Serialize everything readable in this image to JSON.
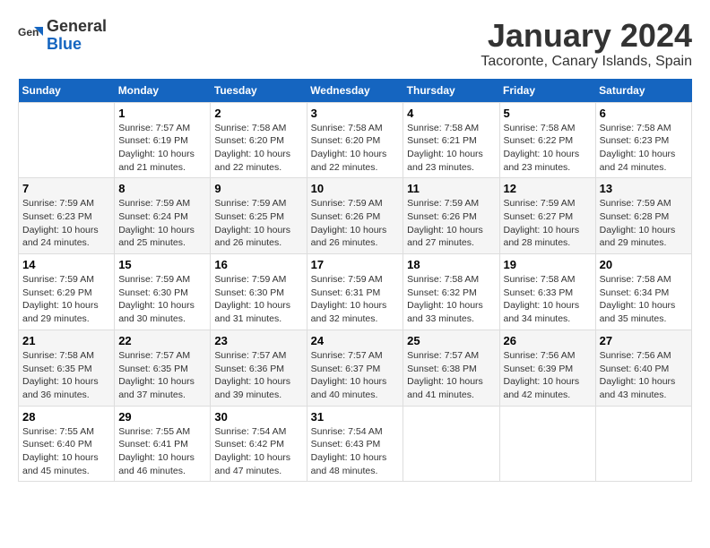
{
  "logo": {
    "general": "General",
    "blue": "Blue"
  },
  "title": "January 2024",
  "location": "Tacoronte, Canary Islands, Spain",
  "days_of_week": [
    "Sunday",
    "Monday",
    "Tuesday",
    "Wednesday",
    "Thursday",
    "Friday",
    "Saturday"
  ],
  "weeks": [
    [
      {
        "day": "",
        "info": ""
      },
      {
        "day": "1",
        "info": "Sunrise: 7:57 AM\nSunset: 6:19 PM\nDaylight: 10 hours\nand 21 minutes."
      },
      {
        "day": "2",
        "info": "Sunrise: 7:58 AM\nSunset: 6:20 PM\nDaylight: 10 hours\nand 22 minutes."
      },
      {
        "day": "3",
        "info": "Sunrise: 7:58 AM\nSunset: 6:20 PM\nDaylight: 10 hours\nand 22 minutes."
      },
      {
        "day": "4",
        "info": "Sunrise: 7:58 AM\nSunset: 6:21 PM\nDaylight: 10 hours\nand 23 minutes."
      },
      {
        "day": "5",
        "info": "Sunrise: 7:58 AM\nSunset: 6:22 PM\nDaylight: 10 hours\nand 23 minutes."
      },
      {
        "day": "6",
        "info": "Sunrise: 7:58 AM\nSunset: 6:23 PM\nDaylight: 10 hours\nand 24 minutes."
      }
    ],
    [
      {
        "day": "7",
        "info": "Sunrise: 7:59 AM\nSunset: 6:23 PM\nDaylight: 10 hours\nand 24 minutes."
      },
      {
        "day": "8",
        "info": "Sunrise: 7:59 AM\nSunset: 6:24 PM\nDaylight: 10 hours\nand 25 minutes."
      },
      {
        "day": "9",
        "info": "Sunrise: 7:59 AM\nSunset: 6:25 PM\nDaylight: 10 hours\nand 26 minutes."
      },
      {
        "day": "10",
        "info": "Sunrise: 7:59 AM\nSunset: 6:26 PM\nDaylight: 10 hours\nand 26 minutes."
      },
      {
        "day": "11",
        "info": "Sunrise: 7:59 AM\nSunset: 6:26 PM\nDaylight: 10 hours\nand 27 minutes."
      },
      {
        "day": "12",
        "info": "Sunrise: 7:59 AM\nSunset: 6:27 PM\nDaylight: 10 hours\nand 28 minutes."
      },
      {
        "day": "13",
        "info": "Sunrise: 7:59 AM\nSunset: 6:28 PM\nDaylight: 10 hours\nand 29 minutes."
      }
    ],
    [
      {
        "day": "14",
        "info": "Sunrise: 7:59 AM\nSunset: 6:29 PM\nDaylight: 10 hours\nand 29 minutes."
      },
      {
        "day": "15",
        "info": "Sunrise: 7:59 AM\nSunset: 6:30 PM\nDaylight: 10 hours\nand 30 minutes."
      },
      {
        "day": "16",
        "info": "Sunrise: 7:59 AM\nSunset: 6:30 PM\nDaylight: 10 hours\nand 31 minutes."
      },
      {
        "day": "17",
        "info": "Sunrise: 7:59 AM\nSunset: 6:31 PM\nDaylight: 10 hours\nand 32 minutes."
      },
      {
        "day": "18",
        "info": "Sunrise: 7:58 AM\nSunset: 6:32 PM\nDaylight: 10 hours\nand 33 minutes."
      },
      {
        "day": "19",
        "info": "Sunrise: 7:58 AM\nSunset: 6:33 PM\nDaylight: 10 hours\nand 34 minutes."
      },
      {
        "day": "20",
        "info": "Sunrise: 7:58 AM\nSunset: 6:34 PM\nDaylight: 10 hours\nand 35 minutes."
      }
    ],
    [
      {
        "day": "21",
        "info": "Sunrise: 7:58 AM\nSunset: 6:35 PM\nDaylight: 10 hours\nand 36 minutes."
      },
      {
        "day": "22",
        "info": "Sunrise: 7:57 AM\nSunset: 6:35 PM\nDaylight: 10 hours\nand 37 minutes."
      },
      {
        "day": "23",
        "info": "Sunrise: 7:57 AM\nSunset: 6:36 PM\nDaylight: 10 hours\nand 39 minutes."
      },
      {
        "day": "24",
        "info": "Sunrise: 7:57 AM\nSunset: 6:37 PM\nDaylight: 10 hours\nand 40 minutes."
      },
      {
        "day": "25",
        "info": "Sunrise: 7:57 AM\nSunset: 6:38 PM\nDaylight: 10 hours\nand 41 minutes."
      },
      {
        "day": "26",
        "info": "Sunrise: 7:56 AM\nSunset: 6:39 PM\nDaylight: 10 hours\nand 42 minutes."
      },
      {
        "day": "27",
        "info": "Sunrise: 7:56 AM\nSunset: 6:40 PM\nDaylight: 10 hours\nand 43 minutes."
      }
    ],
    [
      {
        "day": "28",
        "info": "Sunrise: 7:55 AM\nSunset: 6:40 PM\nDaylight: 10 hours\nand 45 minutes."
      },
      {
        "day": "29",
        "info": "Sunrise: 7:55 AM\nSunset: 6:41 PM\nDaylight: 10 hours\nand 46 minutes."
      },
      {
        "day": "30",
        "info": "Sunrise: 7:54 AM\nSunset: 6:42 PM\nDaylight: 10 hours\nand 47 minutes."
      },
      {
        "day": "31",
        "info": "Sunrise: 7:54 AM\nSunset: 6:43 PM\nDaylight: 10 hours\nand 48 minutes."
      },
      {
        "day": "",
        "info": ""
      },
      {
        "day": "",
        "info": ""
      },
      {
        "day": "",
        "info": ""
      }
    ]
  ]
}
